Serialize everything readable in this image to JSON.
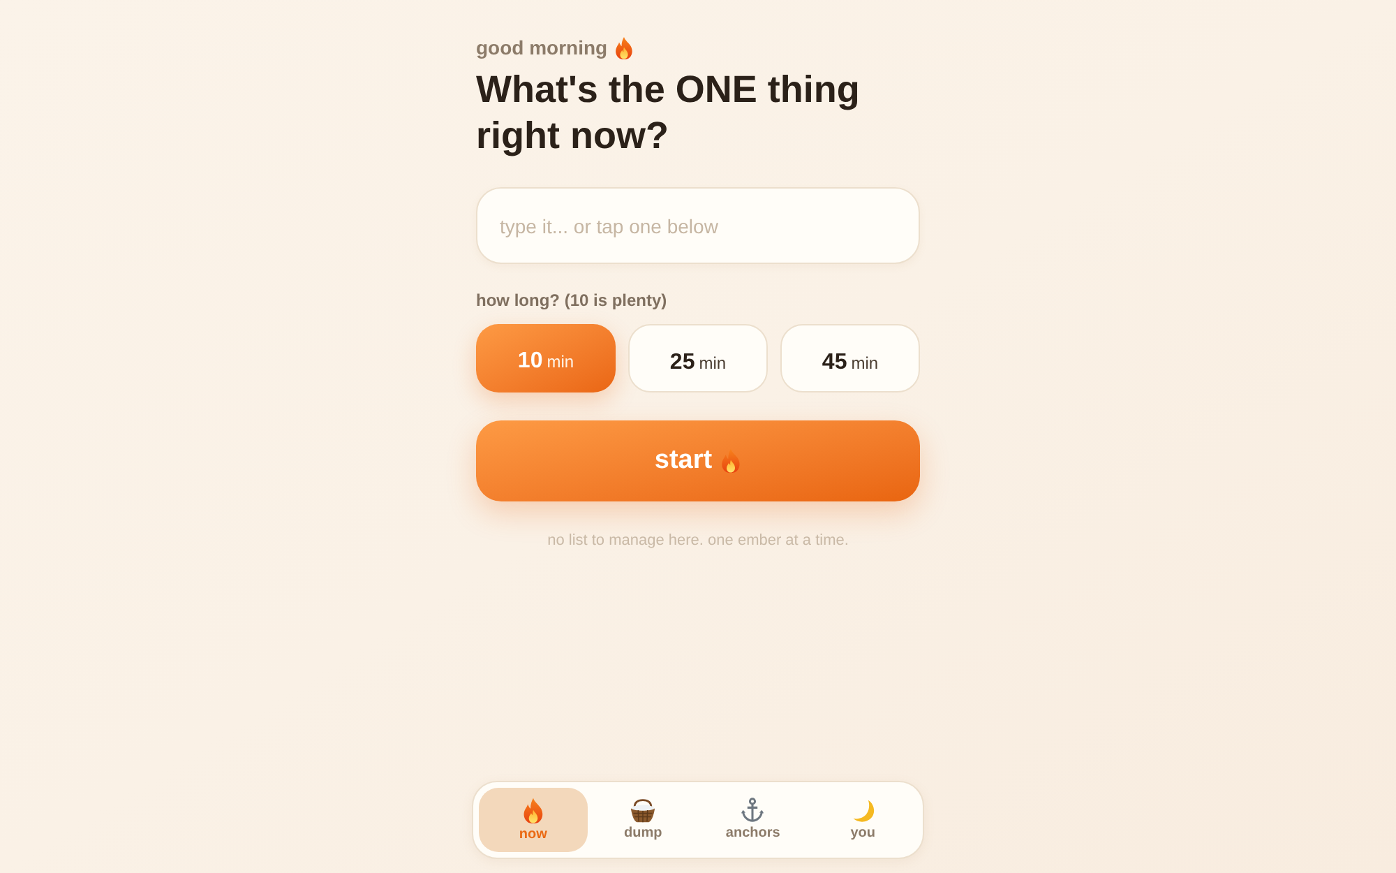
{
  "greeting": "good morning",
  "heading": "What's the ONE thing right now?",
  "task_input": {
    "placeholder": "type it... or tap one below"
  },
  "duration": {
    "label": "how long? (10 is plenty)",
    "options": [
      {
        "value": "10",
        "unit": "min",
        "selected": true
      },
      {
        "value": "25",
        "unit": "min",
        "selected": false
      },
      {
        "value": "45",
        "unit": "min",
        "selected": false
      }
    ]
  },
  "start_button": {
    "label": "start"
  },
  "note": "no list to manage here. one ember at a time.",
  "nav": [
    {
      "label": "now",
      "selected": true
    },
    {
      "label": "dump",
      "selected": false
    },
    {
      "label": "anchors",
      "selected": false
    },
    {
      "label": "you",
      "selected": false
    }
  ]
}
